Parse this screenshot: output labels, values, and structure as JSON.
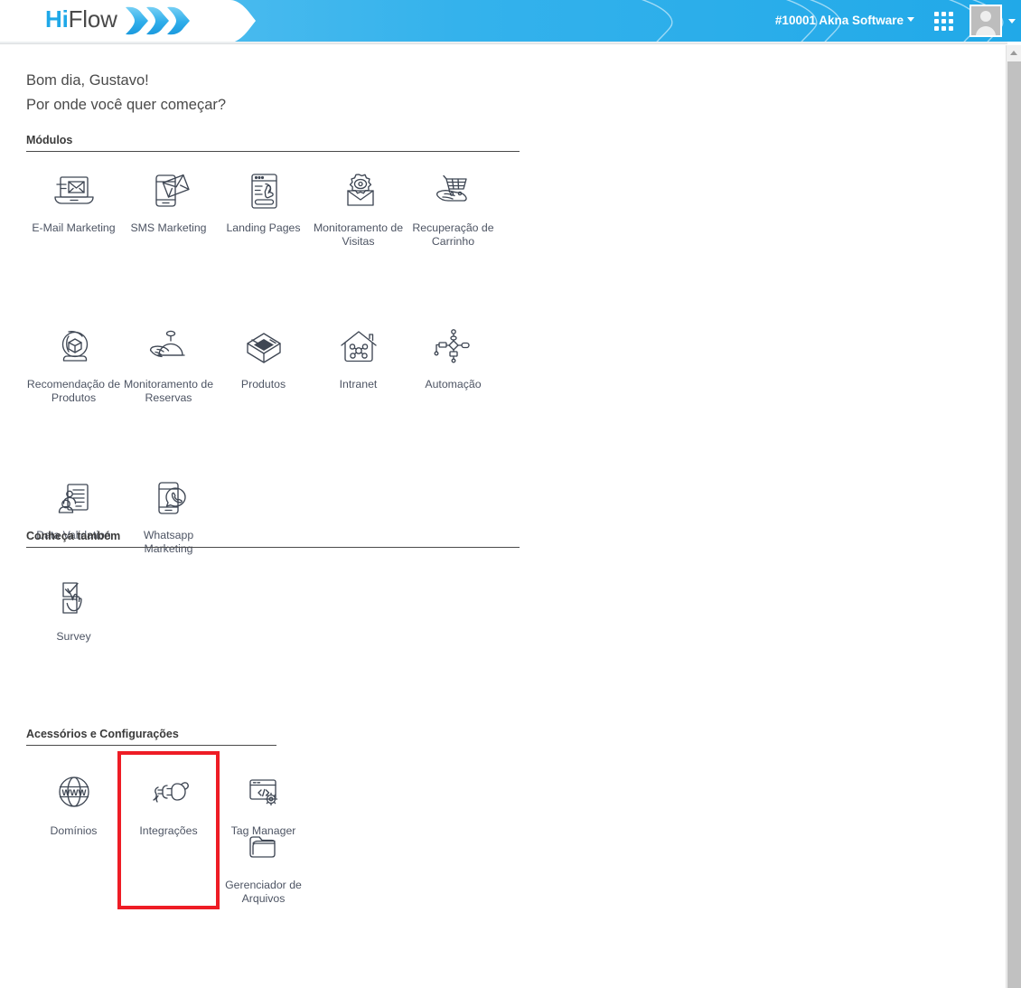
{
  "header": {
    "logo_hi": "Hi",
    "logo_flow": "Flow",
    "logo_icon": "chevrons-icon",
    "account": "#10001 Akna Software",
    "account_caret_icon": "caret-down-icon",
    "apps_icon": "apps-grid-icon",
    "avatar_icon": "user-avatar-icon",
    "avatar_caret_icon": "caret-down-icon",
    "brand_blue": "#33b2ec",
    "logo_blue": "#1fa8e8"
  },
  "greeting": {
    "line1": "Bom dia, Gustavo!",
    "line2": "Por onde você quer começar?"
  },
  "sections": [
    {
      "title": "Módulos",
      "rule_width": 546,
      "tiles": [
        {
          "label": "E-Mail Marketing",
          "icon": "laptop-envelope-icon"
        },
        {
          "label": "SMS Marketing",
          "icon": "phone-envelope-icon"
        },
        {
          "label": "Landing Pages",
          "icon": "browser-click-icon"
        },
        {
          "label": "Monitoramento de Visitas",
          "icon": "gear-eye-envelope-icon"
        },
        {
          "label": "Recuperação de Carrinho",
          "icon": "hand-cart-icon"
        },
        {
          "label": "Recomendação de Produtos",
          "icon": "crystal-ball-box-icon"
        },
        {
          "label": "Monitoramento de Reservas",
          "icon": "hand-bell-icon"
        },
        {
          "label": "Produtos",
          "icon": "open-box-icon"
        },
        {
          "label": "Intranet",
          "icon": "house-network-icon"
        },
        {
          "label": "Automação",
          "icon": "flowchart-icon"
        },
        {
          "label": "Data Validation",
          "icon": "person-document-icon"
        },
        {
          "label": "Whatsapp Marketing",
          "icon": "phone-whatsapp-icon"
        }
      ]
    },
    {
      "title": "Conheça também",
      "rule_width": 546,
      "tiles": [
        {
          "label": "Survey",
          "icon": "checkbox-hand-icon"
        }
      ]
    },
    {
      "title": "Acessórios e Configurações",
      "rule_width": 277,
      "tiles": [
        {
          "label": "Domínios",
          "icon": "globe-www-icon"
        },
        {
          "label": "Integrações",
          "icon": "plug-socket-icon",
          "highlighted": true
        },
        {
          "label": "Tag Manager",
          "icon": "code-window-gear-icon"
        },
        {
          "label": "Gerenciador de Arquivos",
          "icon": "folder-icon"
        }
      ]
    }
  ],
  "scrollbar": {
    "up_arrow_icon": "scroll-up-arrow-icon",
    "thumb": "scroll-thumb"
  },
  "highlight_color": "#ee1c25"
}
